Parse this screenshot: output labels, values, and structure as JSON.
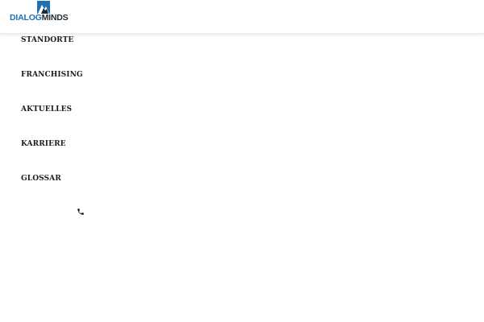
{
  "logo": {
    "part1": "DIALOG",
    "part2": "MINDS",
    "icon": "dialogminds-logo-mark",
    "colors": {
      "dialog": "#1f6fb2",
      "minds": "#1e2a33"
    }
  },
  "nav": {
    "items": [
      {
        "label": "STANDORTE"
      },
      {
        "label": "FRANCHISING"
      },
      {
        "label": "AKTUELLES"
      },
      {
        "label": "KARRIERE"
      },
      {
        "label": "GLOSSAR"
      }
    ]
  },
  "contact": {
    "icon": "phone-icon"
  }
}
